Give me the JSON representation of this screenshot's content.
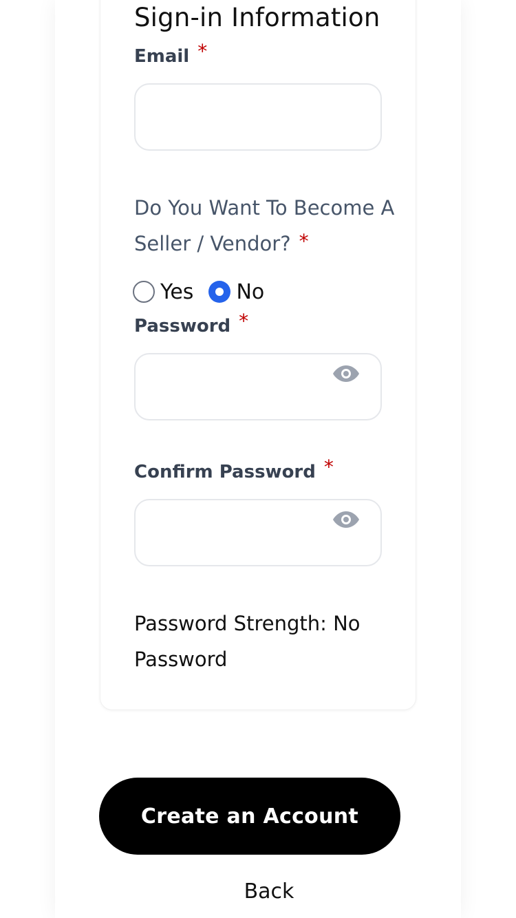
{
  "form": {
    "section_title": "Sign-in Information",
    "email": {
      "label": "Email",
      "required_mark": "*",
      "value": ""
    },
    "seller_question": {
      "label": "Do You Want To Become A Seller / Vendor?",
      "required_mark": "*",
      "options": [
        {
          "label": "Yes",
          "checked": false
        },
        {
          "label": "No",
          "checked": true
        }
      ]
    },
    "password": {
      "label": "Password",
      "required_mark": "*",
      "value": "",
      "toggle_icon": "eye-icon"
    },
    "confirm_password": {
      "label": "Confirm Password",
      "required_mark": "*",
      "value": "",
      "toggle_icon": "eye-icon"
    },
    "password_strength": "Password Strength: No Password"
  },
  "actions": {
    "create_account_label": "Create an Account",
    "back_label": "Back"
  },
  "colors": {
    "accent": "#2563eb",
    "required": "#c00000",
    "button_bg": "#000000",
    "label_text": "#374151",
    "question_text": "#475569"
  }
}
